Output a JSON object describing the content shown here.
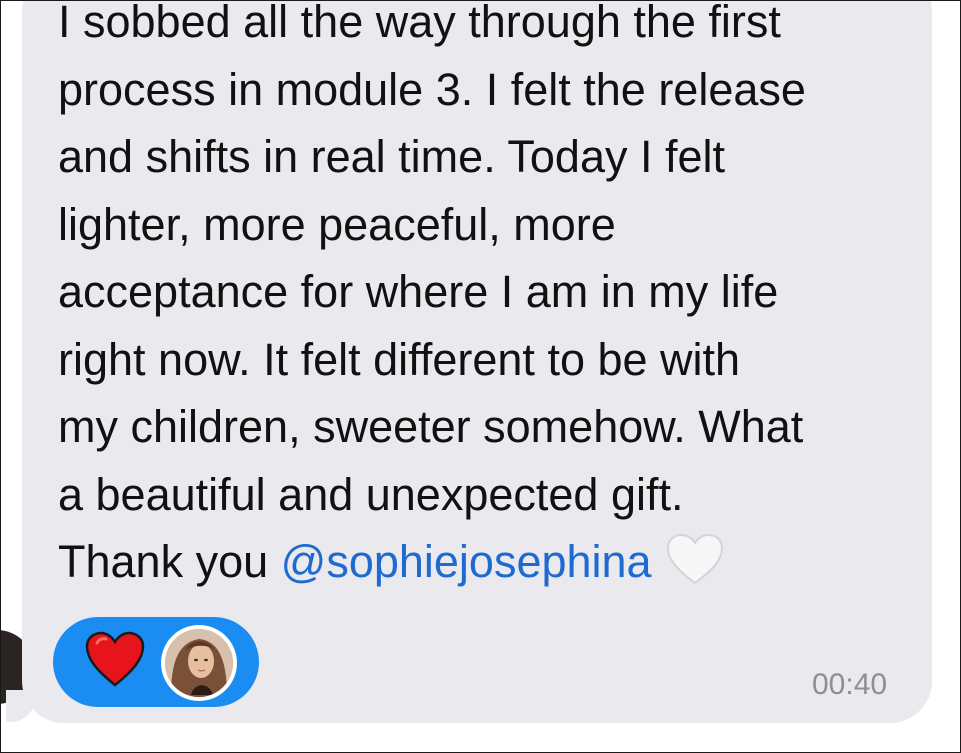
{
  "message": {
    "lines": [
      "I sobbed all the way through the first",
      "process in module 3. I felt the release",
      "and shifts in real time. Today I felt",
      "lighter, more peaceful, more",
      "acceptance for where I am in my life",
      "right now. It felt different to be with",
      "my children, sweeter somehow. What",
      "a beautiful and unexpected gift."
    ],
    "last_line_prefix": "Thank you ",
    "mention": "@sophiejosephina",
    "trailing_emoji": "white-heart-icon",
    "timestamp": "00:40"
  },
  "reactions": {
    "emoji": "red-heart-icon",
    "reactor_avatar": "user-avatar",
    "pill_color": "#1a8cf2"
  },
  "colors": {
    "bubble": "#e9e9ee",
    "text": "#111111",
    "mention": "#1f6ad1",
    "timestamp": "#8e8e93"
  }
}
